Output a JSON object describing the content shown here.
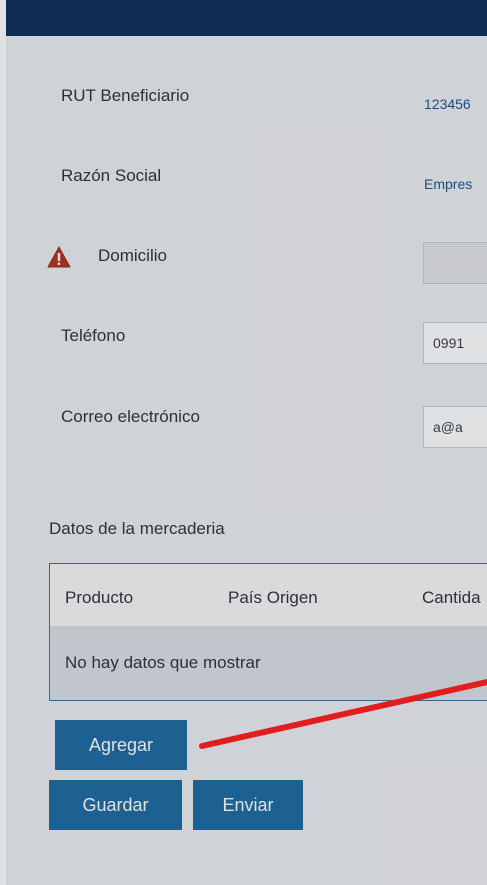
{
  "form": {
    "rut": {
      "label": "RUT Beneficiario",
      "value": "123456"
    },
    "razon": {
      "label": "Razón Social",
      "value": "Empres"
    },
    "domicilio": {
      "label": "Domicilio",
      "value": ""
    },
    "telefono": {
      "label": "Teléfono",
      "value": "0991"
    },
    "correo": {
      "label": "Correo electrónico",
      "value": "a@a"
    }
  },
  "merchandise": {
    "title": "Datos de la mercaderia",
    "columns": [
      "Producto",
      "País Origen",
      "Cantida"
    ],
    "empty_message": "No hay datos que mostrar"
  },
  "buttons": {
    "add": "Agregar",
    "save": "Guardar",
    "send": "Enviar"
  },
  "colors": {
    "header": "#0d2d5b",
    "button": "#1c6aa3",
    "annotation": "#e11d1d",
    "warning": "#b8321d"
  },
  "icons": {
    "warning": "warning-triangle-icon"
  }
}
